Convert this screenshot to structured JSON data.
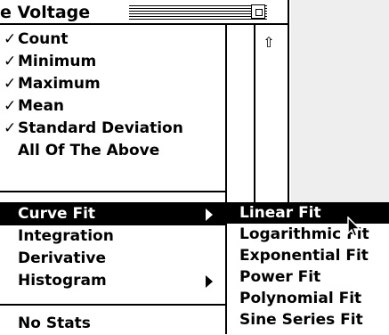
{
  "window": {
    "title": "e Voltage"
  },
  "menu": {
    "items": [
      {
        "check": "✓",
        "label": "Count"
      },
      {
        "check": "✓",
        "label": "Minimum"
      },
      {
        "check": "✓",
        "label": "Maximum"
      },
      {
        "check": "✓",
        "label": "Mean"
      },
      {
        "check": "✓",
        "label": "Standard Deviation"
      },
      {
        "check": "",
        "label": "All Of The Above"
      },
      {
        "check": "",
        "label": "Curve Fit"
      },
      {
        "check": "",
        "label": "Integration"
      },
      {
        "check": "",
        "label": "Derivative"
      },
      {
        "check": "",
        "label": "Histogram"
      },
      {
        "check": "",
        "label": "No Stats"
      }
    ]
  },
  "submenu": {
    "items": [
      {
        "label": "Linear Fit"
      },
      {
        "label": "Logarithmic Fit"
      },
      {
        "label": "Exponential Fit"
      },
      {
        "label": "Power Fit"
      },
      {
        "label": "Polynomial Fit"
      },
      {
        "label": "Sine Series Fit"
      }
    ]
  },
  "colors": {
    "selected_background": "#000000",
    "selected_text": "#ffffff",
    "desktop_gray": "#eeeeee"
  },
  "icons": {
    "scroll_up": "arrow-up-icon",
    "zoom": "zoom-box-icon",
    "submenu_arrow": "triangle-right-icon",
    "cursor": "mouse-pointer-icon",
    "checkmark": "check-icon"
  }
}
